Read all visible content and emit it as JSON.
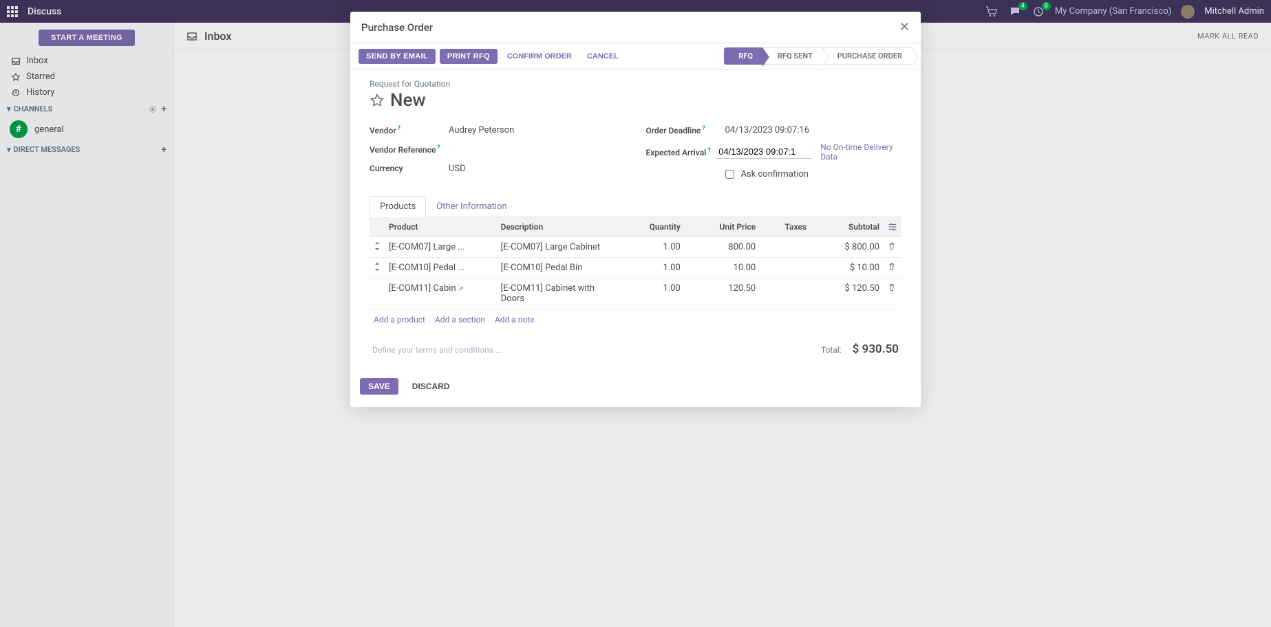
{
  "topnav": {
    "title": "Discuss",
    "chat_badge": "4",
    "clock_badge": "8",
    "company": "My Company (San Francisco)",
    "user": "Mitchell Admin"
  },
  "sidebar": {
    "start_meeting": "START A MEETING",
    "items": [
      {
        "label": "Inbox",
        "icon": "inbox-icon"
      },
      {
        "label": "Starred",
        "icon": "star-icon"
      },
      {
        "label": "History",
        "icon": "history-icon"
      }
    ],
    "channels_header": "CHANNELS",
    "channel_general": "general",
    "dm_header": "DIRECT MESSAGES"
  },
  "main": {
    "inbox_title": "Inbox",
    "mark_all": "MARK ALL READ"
  },
  "modal": {
    "title": "Purchase Order",
    "buttons": {
      "send_email": "SEND BY EMAIL",
      "print_rfq": "PRINT RFQ",
      "confirm": "CONFIRM ORDER",
      "cancel": "CANCEL"
    },
    "status_steps": [
      "RFQ",
      "RFQ SENT",
      "PURCHASE ORDER"
    ],
    "status_active_index": 0,
    "rfq_label": "Request for Quotation",
    "new_title": "New",
    "fields": {
      "vendor_label": "Vendor",
      "vendor_value": "Audrey Peterson",
      "vendor_ref_label": "Vendor Reference",
      "vendor_ref_value": "",
      "currency_label": "Currency",
      "currency_value": "USD",
      "deadline_label": "Order Deadline",
      "deadline_value": "04/13/2023 09:07:16",
      "arrival_label": "Expected Arrival",
      "arrival_value": "04/13/2023 09:07:1",
      "delivery_link": "No On-time Delivery Data",
      "ask_confirmation": "Ask confirmation"
    },
    "tabs": [
      "Products",
      "Other Information"
    ],
    "active_tab": 0,
    "table": {
      "headers": {
        "product": "Product",
        "description": "Description",
        "quantity": "Quantity",
        "unit_price": "Unit Price",
        "taxes": "Taxes",
        "subtotal": "Subtotal"
      },
      "rows": [
        {
          "product": "[E-COM07] Large ...",
          "description": "[E-COM07] Large Cabinet",
          "quantity": "1.00",
          "unit_price": "800.00",
          "taxes": "",
          "subtotal": "$ 800.00",
          "handle": true
        },
        {
          "product": "[E-COM10] Pedal ...",
          "description": "[E-COM10] Pedal Bin",
          "quantity": "1.00",
          "unit_price": "10.00",
          "taxes": "",
          "subtotal": "$ 10.00",
          "handle": true
        },
        {
          "product": "[E-COM11] Cabin",
          "description": "[E-COM11] Cabinet with Doors",
          "quantity": "1.00",
          "unit_price": "120.50",
          "taxes": "",
          "subtotal": "$ 120.50",
          "handle": false,
          "ext_link": true
        }
      ],
      "add_product": "Add a product",
      "add_section": "Add a section",
      "add_note": "Add a note"
    },
    "terms_placeholder": "Define your terms and conditions ...",
    "total_label": "Total:",
    "total_value": "$ 930.50",
    "footer": {
      "save": "SAVE",
      "discard": "DISCARD"
    }
  }
}
